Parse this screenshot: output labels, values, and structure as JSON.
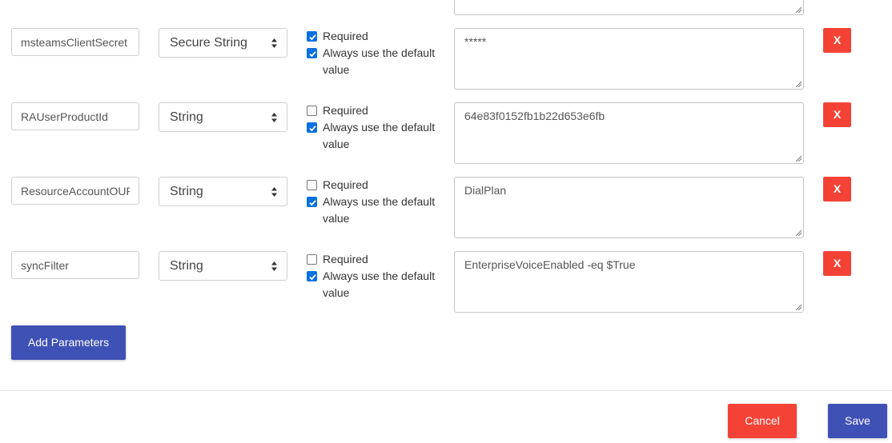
{
  "parameters": [
    {
      "name": "msteamsClientSecret",
      "type": "Secure String",
      "required": true,
      "always_default": true,
      "default_value": "*****"
    },
    {
      "name": "RAUserProductId",
      "type": "String",
      "required": false,
      "always_default": true,
      "default_value": "64e83f0152fb1b22d653e6fb"
    },
    {
      "name": "ResourceAccountOUPath",
      "type": "String",
      "required": false,
      "always_default": true,
      "default_value": "DialPlan"
    },
    {
      "name": "syncFilter",
      "type": "String",
      "required": false,
      "always_default": true,
      "default_value": "EnterpriseVoiceEnabled -eq $True"
    }
  ],
  "labels": {
    "required": "Required",
    "always_default_line1": "Always use the default",
    "always_default_line2": "value",
    "delete": "X",
    "add_parameters": "Add Parameters",
    "cancel": "Cancel",
    "save": "Save"
  },
  "icons": {
    "select_arrows": "sort-arrows-icon",
    "checkbox": "checkmark-icon",
    "resize": "resize-grip-icon"
  },
  "colors": {
    "primary": "#3f51b5",
    "danger": "#f44336",
    "checkbox_checked": "#0b70e0"
  }
}
